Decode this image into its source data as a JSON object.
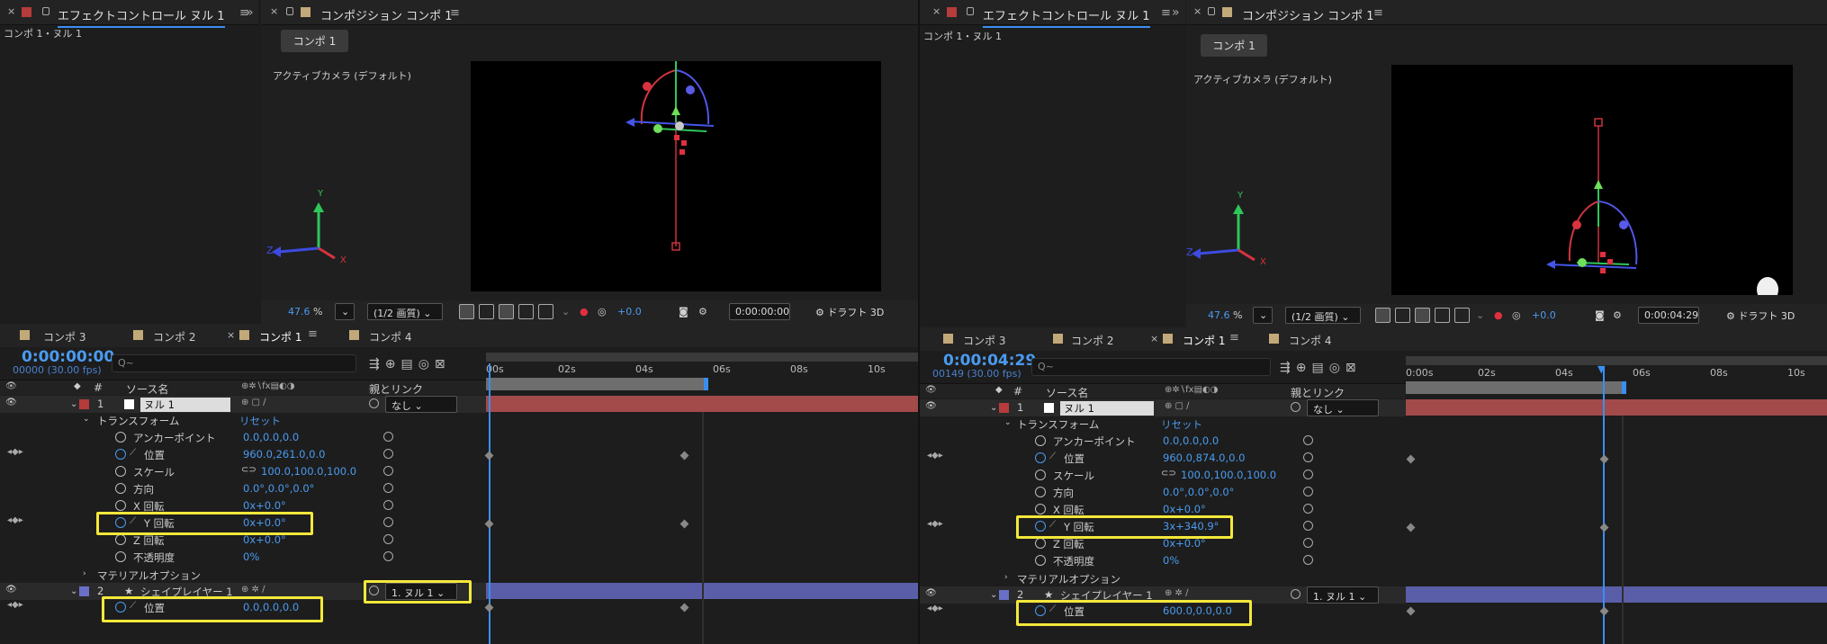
{
  "left": {
    "effect_tab": "エフェクトコントロール ヌル 1",
    "breadcrumb": "コンポ 1・ヌル 1",
    "comp_tab": "コンポジション コンポ 1",
    "comp_button": "コンポ 1",
    "camera_label": "アクティブカメラ (デフォルト)",
    "zoom": "47.6",
    "zoom_unit": "%",
    "quality": "(1/2 画質)",
    "exposure": "+0.0",
    "view_time": "0:00:00:00",
    "draft": "ドラフト 3D",
    "timeline_tabs": [
      "コンポ 3",
      "コンポ 2",
      "コンポ 1",
      "コンポ 4"
    ],
    "timecode": "0:00:00:00",
    "frames": "00000 (30.00 fps)",
    "search_placeholder": "Q~",
    "ruler": [
      "00s",
      "02s",
      "04s",
      "06s",
      "08s",
      "10s"
    ],
    "layer1": {
      "num": "1",
      "name": "ヌル 1",
      "parent": "なし"
    },
    "transform": "トランスフォーム",
    "reset": "リセット",
    "props": [
      {
        "name": "アンカーポイント",
        "value": "0.0,0.0,0.0"
      },
      {
        "name": "位置",
        "value": "960.0,261.0,0.0"
      },
      {
        "name": "スケール",
        "value": "100.0,100.0,100.0"
      },
      {
        "name": "方向",
        "value": "0.0°,0.0°,0.0°"
      },
      {
        "name": "X 回転",
        "value": "0x+0.0°"
      },
      {
        "name": "Y 回転",
        "value": "0x+0.0°"
      },
      {
        "name": "Z 回転",
        "value": "0x+0.0°"
      },
      {
        "name": "不透明度",
        "value": "0%"
      }
    ],
    "material": "マテリアルオプション",
    "layer2": {
      "num": "2",
      "name": "シェイプレイヤー 1",
      "parent": "1. ヌル 1"
    },
    "layer2_prop": {
      "name": "位置",
      "value": "0.0,0.0,0.0"
    }
  },
  "right": {
    "effect_tab": "エフェクトコントロール ヌル 1",
    "breadcrumb": "コンポ 1・ヌル 1",
    "comp_tab": "コンポジション コンポ 1",
    "comp_button": "コンポ 1",
    "camera_label": "アクティブカメラ (デフォルト)",
    "zoom": "47.6",
    "zoom_unit": "%",
    "quality": "(1/2 画質)",
    "exposure": "+0.0",
    "view_time": "0:00:04:29",
    "draft": "ドラフト 3D",
    "timeline_tabs": [
      "コンポ 3",
      "コンポ 2",
      "コンポ 1",
      "コンポ 4"
    ],
    "timecode": "0:00:04:29",
    "frames": "00149 (30.00 fps)",
    "search_placeholder": "Q~",
    "ruler": [
      "0:00s",
      "02s",
      "04s",
      "06s",
      "08s",
      "10s"
    ],
    "layer1": {
      "num": "1",
      "name": "ヌル 1",
      "parent": "なし"
    },
    "transform": "トランスフォーム",
    "reset": "リセット",
    "props": [
      {
        "name": "アンカーポイント",
        "value": "0.0,0.0,0.0"
      },
      {
        "name": "位置",
        "value": "960.0,874.0,0.0"
      },
      {
        "name": "スケール",
        "value": "100.0,100.0,100.0"
      },
      {
        "name": "方向",
        "value": "0.0°,0.0°,0.0°"
      },
      {
        "name": "X 回転",
        "value": "0x+0.0°"
      },
      {
        "name": "Y 回転",
        "value": "3x+340.9°"
      },
      {
        "name": "Z 回転",
        "value": "0x+0.0°"
      },
      {
        "name": "不透明度",
        "value": "0%"
      }
    ],
    "material": "マテリアルオプション",
    "layer2": {
      "num": "2",
      "name": "シェイプレイヤー 1",
      "parent": "1. ヌル 1"
    },
    "layer2_prop": {
      "name": "位置",
      "value": "600.0,0.0,0.0"
    }
  },
  "headers": {
    "source": "ソース名",
    "parent_link": "親とリンク",
    "hash": "#"
  },
  "axes": {
    "x": "X",
    "y": "Y",
    "z": "Z"
  },
  "colors": {
    "accent": "#3a8ef0",
    "highlight": "#f4e83a",
    "null_label": "#b63b3b",
    "shape_label": "#6a6fc8",
    "value_blue": "#4a9bf0"
  },
  "icons": [
    "eye-icon",
    "lock-icon",
    "stopwatch-icon",
    "graph-icon",
    "pickwhip-icon",
    "keyframe-nav-icon",
    "camera-icon",
    "chevron-down-icon",
    "close-icon",
    "hamburger-menu-icon"
  ]
}
